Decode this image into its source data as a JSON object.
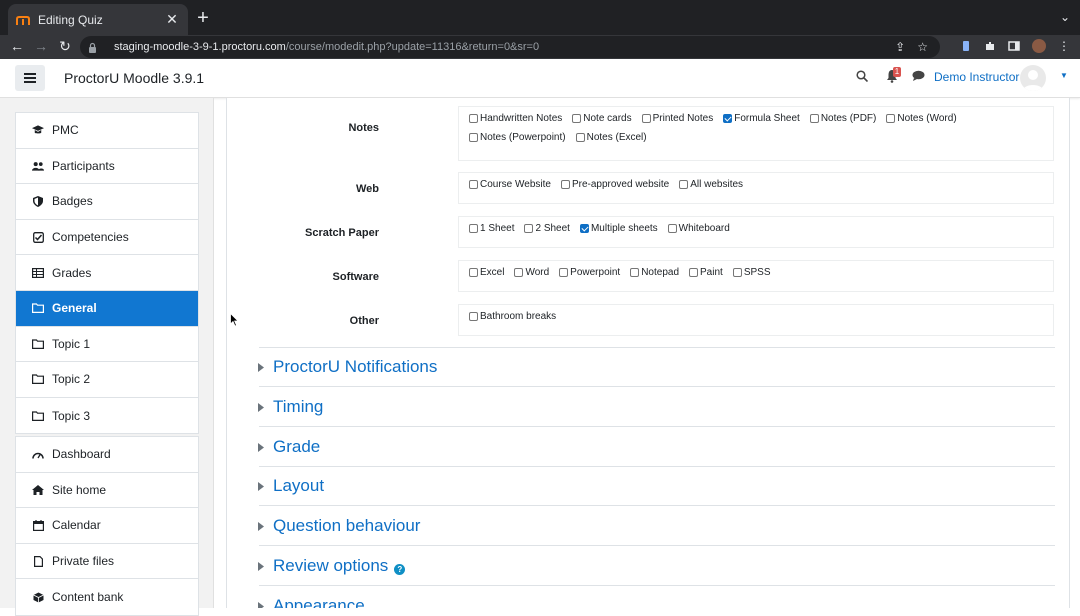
{
  "browser": {
    "tab_title": "Editing Quiz",
    "url_host": "staging-moodle-3-9-1.proctoru.com",
    "url_path": "/course/modedit.php?update=11316&return=0&sr=0"
  },
  "header": {
    "site_name": "ProctorU Moodle 3.9.1",
    "notification_count": "1",
    "user_name": "Demo Instructor"
  },
  "sidebar": {
    "course_items": [
      {
        "label": "PMC",
        "icon": "graduation-cap-icon"
      },
      {
        "label": "Participants",
        "icon": "users-icon"
      },
      {
        "label": "Badges",
        "icon": "shield-icon"
      },
      {
        "label": "Competencies",
        "icon": "check-square-icon"
      },
      {
        "label": "Grades",
        "icon": "table-icon"
      },
      {
        "label": "General",
        "icon": "folder-icon",
        "active": true
      },
      {
        "label": "Topic 1",
        "icon": "folder-icon"
      },
      {
        "label": "Topic 2",
        "icon": "folder-icon"
      },
      {
        "label": "Topic 3",
        "icon": "folder-icon"
      }
    ],
    "site_items": [
      {
        "label": "Dashboard",
        "icon": "dashboard-icon"
      },
      {
        "label": "Site home",
        "icon": "home-icon"
      },
      {
        "label": "Calendar",
        "icon": "calendar-icon"
      },
      {
        "label": "Private files",
        "icon": "file-icon"
      },
      {
        "label": "Content bank",
        "icon": "cube-icon"
      }
    ]
  },
  "permissions": {
    "notes": {
      "label": "Notes",
      "options": [
        {
          "label": "Handwritten Notes",
          "checked": false
        },
        {
          "label": "Note cards",
          "checked": false
        },
        {
          "label": "Printed Notes",
          "checked": false
        },
        {
          "label": "Formula Sheet",
          "checked": true
        },
        {
          "label": "Notes (PDF)",
          "checked": false
        },
        {
          "label": "Notes (Word)",
          "checked": false
        },
        {
          "label": "Notes (Powerpoint)",
          "checked": false
        },
        {
          "label": "Notes (Excel)",
          "checked": false
        }
      ]
    },
    "web": {
      "label": "Web",
      "options": [
        {
          "label": "Course Website",
          "checked": false
        },
        {
          "label": "Pre-approved website",
          "checked": false
        },
        {
          "label": "All websites",
          "checked": false
        }
      ]
    },
    "scratch": {
      "label": "Scratch Paper",
      "options": [
        {
          "label": "1 Sheet",
          "checked": false
        },
        {
          "label": "2 Sheet",
          "checked": false
        },
        {
          "label": "Multiple sheets",
          "checked": true
        },
        {
          "label": "Whiteboard",
          "checked": false
        }
      ]
    },
    "software": {
      "label": "Software",
      "options": [
        {
          "label": "Excel",
          "checked": false
        },
        {
          "label": "Word",
          "checked": false
        },
        {
          "label": "Powerpoint",
          "checked": false
        },
        {
          "label": "Notepad",
          "checked": false
        },
        {
          "label": "Paint",
          "checked": false
        },
        {
          "label": "SPSS",
          "checked": false
        }
      ]
    },
    "other": {
      "label": "Other",
      "options": [
        {
          "label": "Bathroom breaks",
          "checked": false
        }
      ]
    }
  },
  "sections": [
    {
      "title": "ProctorU Notifications",
      "help": false
    },
    {
      "title": "Timing",
      "help": false
    },
    {
      "title": "Grade",
      "help": false
    },
    {
      "title": "Layout",
      "help": false
    },
    {
      "title": "Question behaviour",
      "help": false
    },
    {
      "title": "Review options",
      "help": true
    },
    {
      "title": "Appearance",
      "help": false
    }
  ]
}
